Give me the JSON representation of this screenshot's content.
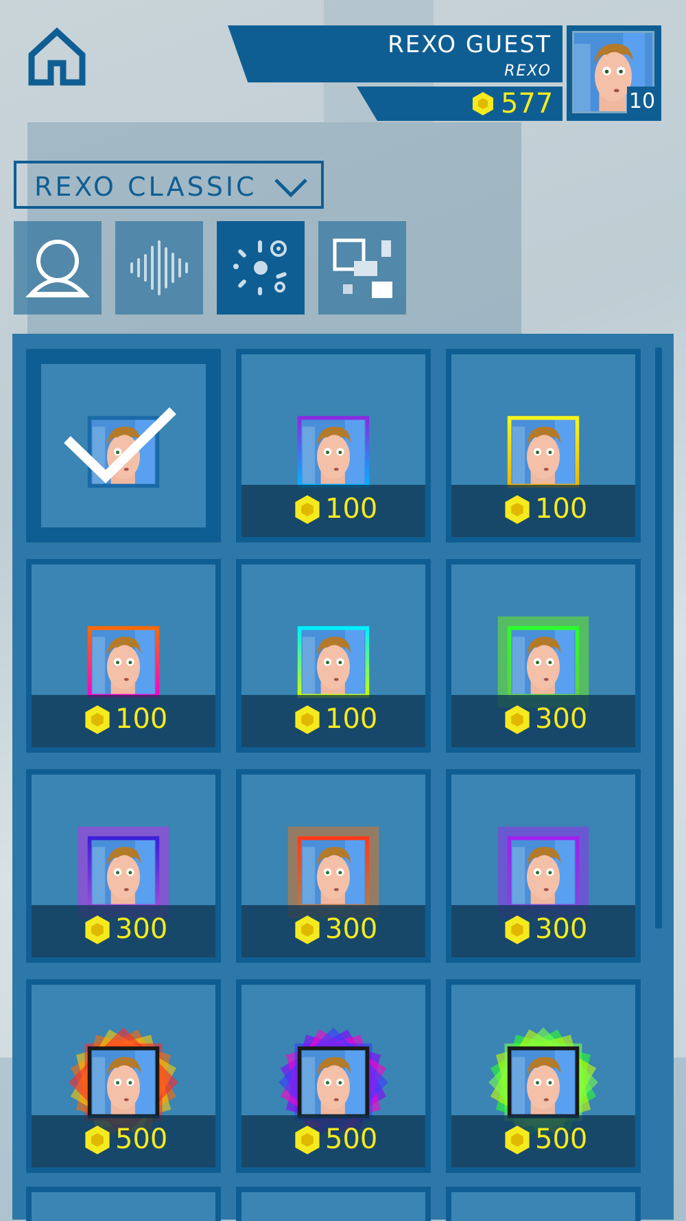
{
  "header": {
    "player_name": "REXO GUEST",
    "player_sub": "REXO",
    "coins": "577",
    "level": "10"
  },
  "dropdown": {
    "label": "REXO CLASSIC"
  },
  "tabs": [
    {
      "icon": "avatar-icon",
      "active": false
    },
    {
      "icon": "sound-wave-icon",
      "active": false
    },
    {
      "icon": "effects-icon",
      "active": true
    },
    {
      "icon": "squares-icon",
      "active": false
    }
  ],
  "colors": {
    "primary": "#0f5e93",
    "panel": "#2d78a8",
    "coin": "#f5ea1e"
  },
  "items": [
    {
      "price": "",
      "selected": true,
      "frame": "none",
      "frame_colors": [
        "#3a9ad9",
        "#3a9ad9"
      ]
    },
    {
      "price": "100",
      "selected": false,
      "frame": "gradient",
      "frame_colors": [
        "#8a2be2",
        "#00b4ff"
      ]
    },
    {
      "price": "100",
      "selected": false,
      "frame": "gradient",
      "frame_colors": [
        "#f5f51e",
        "#f0b400"
      ]
    },
    {
      "price": "100",
      "selected": false,
      "frame": "gradient",
      "frame_colors": [
        "#ff6a00",
        "#ff00cc"
      ]
    },
    {
      "price": "100",
      "selected": false,
      "frame": "gradient",
      "frame_colors": [
        "#00f0ff",
        "#c8ff00"
      ]
    },
    {
      "price": "300",
      "selected": false,
      "frame": "glow",
      "frame_colors": [
        "#2bff2b",
        "#5fcf4a"
      ]
    },
    {
      "price": "300",
      "selected": false,
      "frame": "glow",
      "frame_colors": [
        "#3a1fd9",
        "#9a4ad9"
      ]
    },
    {
      "price": "300",
      "selected": false,
      "frame": "glow",
      "frame_colors": [
        "#ff3a1a",
        "#b37a4a"
      ]
    },
    {
      "price": "300",
      "selected": false,
      "frame": "glow",
      "frame_colors": [
        "#a020f0",
        "#7a4ad9"
      ]
    },
    {
      "price": "500",
      "selected": false,
      "frame": "burst",
      "frame_colors": [
        "#ff6a00",
        "#ffcc00",
        "#ff2a2a"
      ]
    },
    {
      "price": "500",
      "selected": false,
      "frame": "burst",
      "frame_colors": [
        "#8a00ff",
        "#ff00cc",
        "#3a3aff"
      ]
    },
    {
      "price": "500",
      "selected": false,
      "frame": "burst",
      "frame_colors": [
        "#2bff2b",
        "#c8ff00",
        "#7aff4a"
      ]
    }
  ]
}
